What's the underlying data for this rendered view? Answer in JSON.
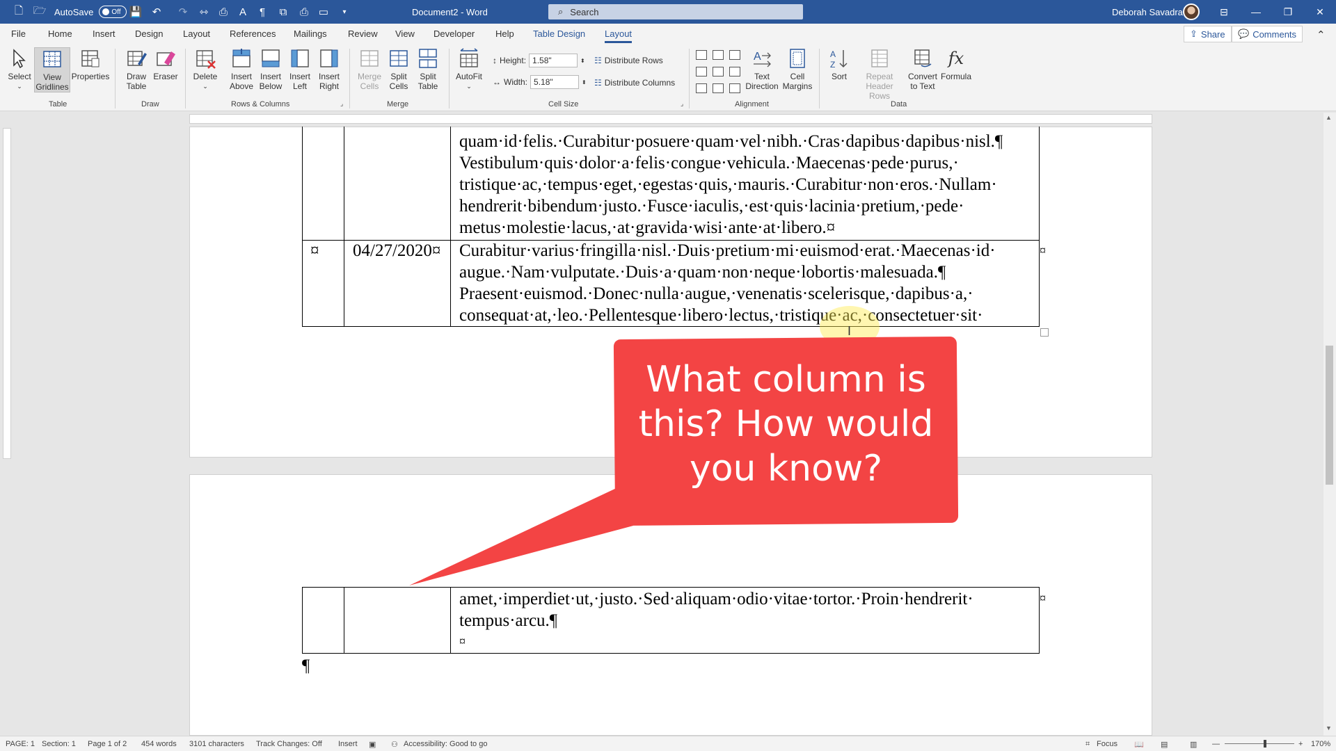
{
  "titlebar": {
    "autosave_label": "AutoSave",
    "autosave_state": "Off",
    "document_title": "Document2  -  Word",
    "search_placeholder": "Search",
    "user_name": "Deborah Savadra"
  },
  "menu": {
    "tabs": [
      "File",
      "Home",
      "Insert",
      "Design",
      "Layout",
      "References",
      "Mailings",
      "Review",
      "View",
      "Developer",
      "Help",
      "Table Design",
      "Layout"
    ],
    "share_label": "Share",
    "comments_label": "Comments"
  },
  "ribbon": {
    "table": {
      "group": "Table",
      "select": "Select",
      "view_gridlines": [
        "View",
        "Gridlines"
      ],
      "properties": "Properties"
    },
    "draw": {
      "group": "Draw",
      "draw_table": [
        "Draw",
        "Table"
      ],
      "eraser": "Eraser"
    },
    "rows_columns": {
      "group": "Rows & Columns",
      "delete": "Delete",
      "insert_above": [
        "Insert",
        "Above"
      ],
      "insert_below": [
        "Insert",
        "Below"
      ],
      "insert_left": [
        "Insert",
        "Left"
      ],
      "insert_right": [
        "Insert",
        "Right"
      ]
    },
    "merge": {
      "group": "Merge",
      "merge_cells": [
        "Merge",
        "Cells"
      ],
      "split_cells": [
        "Split",
        "Cells"
      ],
      "split_table": [
        "Split",
        "Table"
      ]
    },
    "cell_size": {
      "group": "Cell Size",
      "autofit": "AutoFit",
      "height_label": "Height:",
      "height_value": "1.58\"",
      "width_label": "Width:",
      "width_value": "5.18\"",
      "distribute_rows": "Distribute Rows",
      "distribute_columns": "Distribute Columns"
    },
    "alignment": {
      "group": "Alignment",
      "text_direction": [
        "Text",
        "Direction"
      ],
      "cell_margins": [
        "Cell",
        "Margins"
      ]
    },
    "data": {
      "group": "Data",
      "sort": "Sort",
      "repeat_header_rows": [
        "Repeat",
        "Header Rows"
      ],
      "convert_to_text": [
        "Convert",
        "to Text"
      ],
      "formula": "Formula",
      "formula_glyph": "fx"
    }
  },
  "document": {
    "row1_col3_lines": [
      "quam·id·felis.·Curabitur·posuere·quam·vel·nibh.·Cras·dapibus·dapibus·nisl.¶",
      "Vestibulum·quis·dolor·a·felis·congue·vehicula.·Maecenas·pede·purus,·",
      "tristique·ac,·tempus·eget,·egestas·quis,·mauris.·Curabitur·non·eros.·Nullam·",
      "hendrerit·bibendum·justo.·Fusce·iaculis,·est·quis·lacinia·pretium,·pede·",
      "metus·molestie·lacus,·at·gravida·wisi·ante·at·libero.¤"
    ],
    "row2_col1": "¤",
    "row2_col2": "04/27/2020¤",
    "row2_col3_lines": [
      "Curabitur·varius·fringilla·nisl.·Duis·pretium·mi·euismod·erat.·Maecenas·id·",
      "augue.·Nam·vulputate.·Duis·a·quam·non·neque·lobortis·malesuada.¶",
      "Praesent·euismod.·Donec·nulla·augue,·venenatis·scelerisque,·dapibus·a,·",
      "consequat·at,·leo.·Pellentesque·libero·lectus,·tristique·ac,·consectetuer·sit·"
    ],
    "row_end_mark": "¤",
    "page2_lines": [
      "amet,·imperdiet·ut,·justo.·Sed·aliquam·odio·vitae·tortor.·Proin·hendrerit·",
      "tempus·arcu.¶",
      "¤"
    ],
    "para_mark": "¶"
  },
  "callout": {
    "lines": [
      "What column is",
      "this? How would",
      "you know?"
    ],
    "color": "#f34444"
  },
  "statusbar": {
    "page": "PAGE: 1",
    "section": "Section: 1",
    "page_of": "Page 1 of 2",
    "words": "454 words",
    "characters": "3101 characters",
    "track_changes": "Track Changes: Off",
    "insert_mode": "Insert",
    "accessibility": "Accessibility: Good to go",
    "focus": "Focus",
    "zoom": "170%"
  },
  "colors": {
    "word_blue": "#2b579a",
    "ribbon_bg": "#f3f3f3"
  }
}
